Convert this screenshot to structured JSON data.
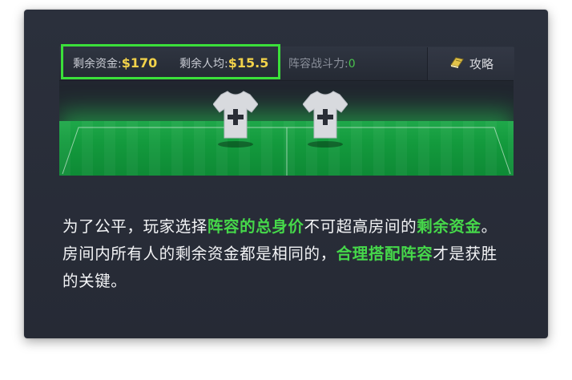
{
  "stats": {
    "remaining_funds_label": "剩余资金:",
    "remaining_funds_value": "$170",
    "per_person_label": "剩余人均:",
    "per_person_value": "$15.5",
    "lineup_power_label": "阵容战斗力:",
    "lineup_power_value": "0"
  },
  "guide_button": {
    "label": "攻略",
    "icon": "book-icon"
  },
  "lineup": {
    "slots": [
      {
        "icon": "shirt-add-icon",
        "glyph": "+"
      },
      {
        "icon": "shirt-add-icon",
        "glyph": "+"
      }
    ]
  },
  "description": {
    "p1": "为了公平，玩家选择",
    "h1": "阵容的总身价",
    "p2": "不可超高房间的",
    "h2": "剩余资金",
    "p3": "。房间内所有人的剩余资金都是相同的，",
    "h3": "合理搭配阵容",
    "p4": "才是获胜的关键。"
  },
  "colors": {
    "highlight_green": "#46d84a",
    "box_border": "#3be03a",
    "gold_value": "#f2d24a",
    "card_bg": "#2b303c"
  }
}
